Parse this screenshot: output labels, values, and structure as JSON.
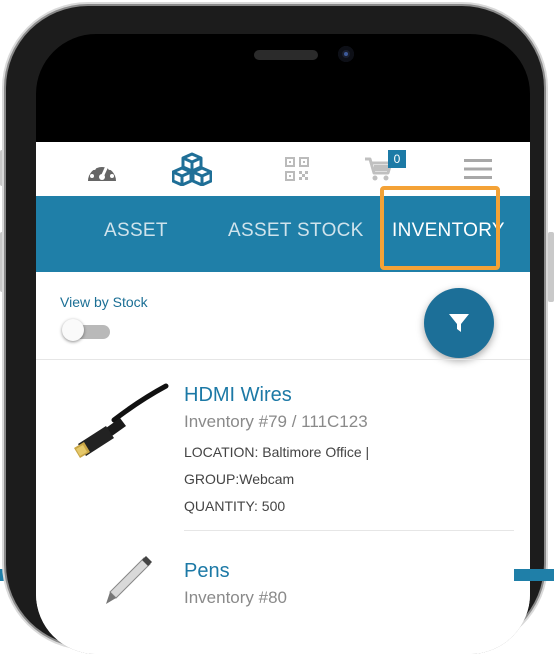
{
  "topbar": {
    "icons": [
      "dashboard-icon",
      "assets-icon",
      "qr-code-icon",
      "cart-icon",
      "menu-icon"
    ],
    "cart_count": "0"
  },
  "tabs": [
    {
      "label": "ASSET",
      "active": false
    },
    {
      "label": "ASSET STOCK",
      "active": false
    },
    {
      "label": "INVENTORY",
      "active": true
    }
  ],
  "view_by_stock": {
    "label": "View by Stock",
    "enabled": false
  },
  "items": [
    {
      "title": "HDMI Wires",
      "subtitle": "Inventory #79 / 111C123",
      "location": "LOCATION: Baltimore Office |",
      "group": "GROUP:Webcam",
      "quantity": "QUANTITY: 500",
      "image": "hdmi-cable-image"
    },
    {
      "title": "Pens",
      "subtitle": "Inventory #80",
      "image": "pen-image"
    }
  ],
  "colors": {
    "primary": "#1f7fa8",
    "highlight": "#f4a236",
    "title": "#1c79a6"
  }
}
